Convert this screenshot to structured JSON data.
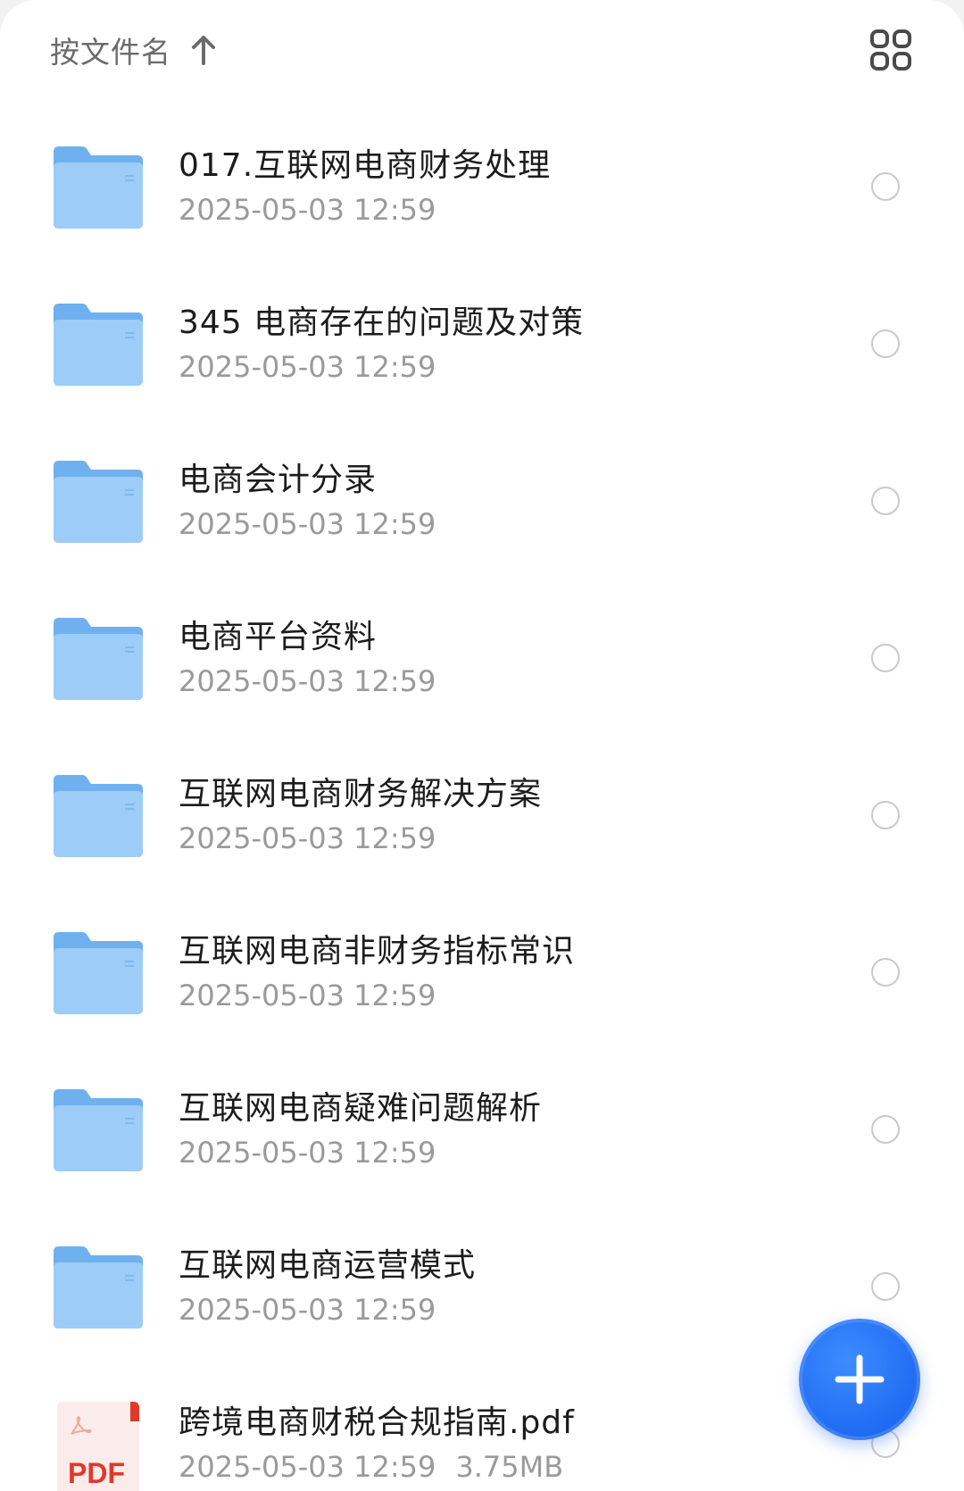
{
  "sort": {
    "label": "按文件名",
    "direction_icon": "arrow-up-icon"
  },
  "view_toggle": {
    "icon": "grid-view-icon"
  },
  "files": [
    {
      "type": "folder",
      "name": "017.互联网电商财务处理",
      "date": "2025-05-03 12:59",
      "size": ""
    },
    {
      "type": "folder",
      "name": "345 电商存在的问题及对策",
      "date": "2025-05-03 12:59",
      "size": ""
    },
    {
      "type": "folder",
      "name": "电商会计分录",
      "date": "2025-05-03 12:59",
      "size": ""
    },
    {
      "type": "folder",
      "name": "电商平台资料",
      "date": "2025-05-03 12:59",
      "size": ""
    },
    {
      "type": "folder",
      "name": "互联网电商财务解决方案",
      "date": "2025-05-03 12:59",
      "size": ""
    },
    {
      "type": "folder",
      "name": "互联网电商非财务指标常识",
      "date": "2025-05-03 12:59",
      "size": ""
    },
    {
      "type": "folder",
      "name": "互联网电商疑难问题解析",
      "date": "2025-05-03 12:59",
      "size": ""
    },
    {
      "type": "folder",
      "name": "互联网电商运营模式",
      "date": "2025-05-03 12:59",
      "size": ""
    },
    {
      "type": "pdf",
      "name": "跨境电商财税合规指南.pdf",
      "date": "2025-05-03 12:59",
      "size": "3.75MB",
      "badge": "PDF"
    }
  ],
  "fab": {
    "icon": "plus-icon"
  },
  "colors": {
    "folder": "#8ec3f5",
    "accent": "#1f6bf2",
    "pdf_red": "#e0392b",
    "text_primary": "#1c1c1c",
    "text_secondary": "#9a9a9a"
  }
}
